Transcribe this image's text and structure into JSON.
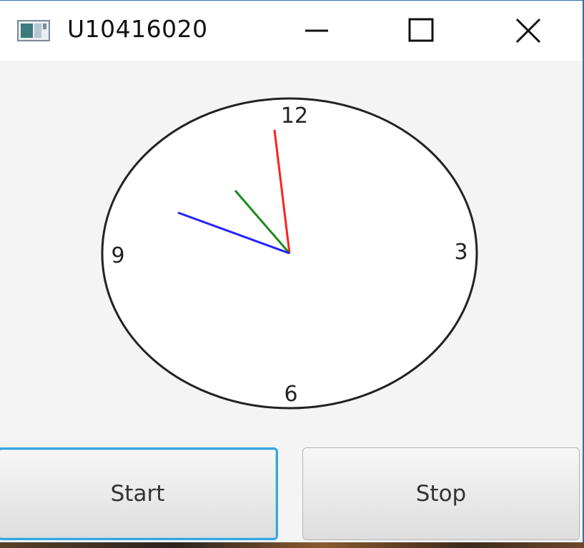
{
  "window": {
    "title": "U10416020",
    "icons": {
      "app": "app-window-icon",
      "minimize": "minimize-icon",
      "maximize": "maximize-icon",
      "close": "close-icon"
    }
  },
  "clock": {
    "numerals": {
      "twelve": "12",
      "three": "3",
      "six": "6",
      "nine": "9"
    },
    "hand_colors": {
      "hour": "#2222ff",
      "minute": "#1a8a1a",
      "second": "#ff2020"
    }
  },
  "buttons": {
    "start_label": "Start",
    "stop_label": "Stop"
  }
}
